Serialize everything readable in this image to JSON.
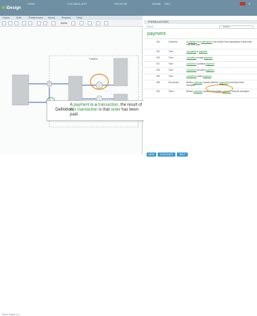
{
  "app": {
    "brand": "iDesign"
  },
  "topnav": [
    "VIEW",
    "VOCABULARY",
    "RECEIVE",
    "HOME",
    "KBC"
  ],
  "menubar": [
    "Home",
    "Edit",
    "Preferences",
    "About",
    "Reports",
    "Help"
  ],
  "toolbar": {
    "zoom": "100%"
  },
  "diagram": {
    "pool_label": "Patient",
    "tooltip_label": "Definition:",
    "tooltip_text": {
      "a": "A",
      "payment": "payment",
      "is_a": "is a",
      "transaction": "transaction",
      "rest1": ", the result of",
      "this": "this",
      "transaction2": "transaction",
      "rest2": "is that",
      "order": "order",
      "rest3": "has been paid."
    }
  },
  "status": "iSeek Status 1.0",
  "panel": {
    "title": "FORMULATIONS",
    "find_label": "Find it",
    "search_placeholder": "Search",
    "term": "payment",
    "rows": [
      {
        "id": "356",
        "type": "Definition",
        "text_pre": "A ",
        "t1": "payment",
        "text_mid": " is a ",
        "t2": "transaction",
        "text_post": ", the result of this transaction is that order has been paid."
      },
      {
        "id": "553",
        "type": "Term",
        "text_pre": "",
        "t1": "completes",
        "text_mid": " a ",
        "t2": "payment",
        "text_post": ""
      },
      {
        "id": "556",
        "type": "Term",
        "text_pre": "",
        "t1": "completes",
        "text_mid": " receipt ",
        "t2": "payment",
        "text_post": ""
      },
      {
        "id": "557",
        "type": "Term",
        "text_pre": "",
        "t1": "customers",
        "text_mid": " confirms ",
        "t2": "payment",
        "text_post": ""
      },
      {
        "id": "558",
        "type": "Term",
        "text_pre": "",
        "t1": "customers",
        "text_mid": " chooses ",
        "t2": "payment",
        "text_post": ""
      },
      {
        "id": "559",
        "type": "Term",
        "text_pre": "",
        "t1": "customers",
        "text_mid": " make ",
        "t2": "payment",
        "text_post": ""
      },
      {
        "id": "568",
        "type": "Necessary",
        "text_pre": "Before ",
        "t1": "customer",
        "text_mid": " request delivery, ",
        "t2": "payment",
        "text_post": " must have been accepted."
      },
      {
        "id": "605",
        "type": "Other",
        "text_pre": "Before ",
        "t1": "customer",
        "text_mid": " request preparation ",
        "t2": "payment",
        "text_post": " must be accepted."
      }
    ]
  },
  "buttons": [
    "NEW",
    "DUPLICATE",
    "HELP"
  ],
  "colors": {
    "topbar": "#6f8fa3",
    "accent": "#3d9bd0",
    "term_green": "#2a8f3a",
    "highlight": "#e08b1b"
  }
}
